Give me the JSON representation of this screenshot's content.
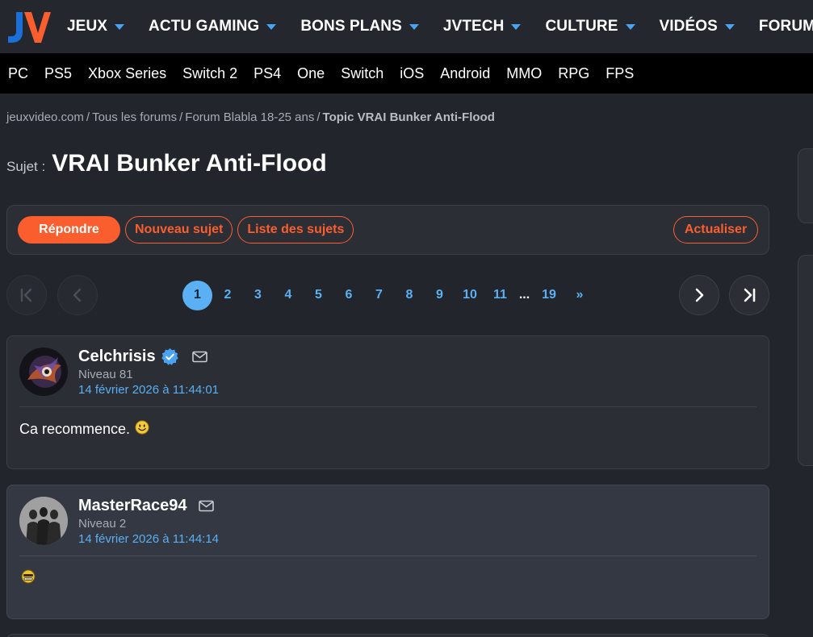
{
  "nav": {
    "items": [
      {
        "label": "JEUX"
      },
      {
        "label": "ACTU GAMING"
      },
      {
        "label": "BONS PLANS"
      },
      {
        "label": "JVTECH"
      },
      {
        "label": "CULTURE"
      },
      {
        "label": "VIDÉOS"
      },
      {
        "label": "FORUMS"
      }
    ],
    "accent": "#4aa3f0"
  },
  "subnav": {
    "items": [
      "PC",
      "PS5",
      "Xbox Series",
      "Switch 2",
      "PS4",
      "One",
      "Switch",
      "iOS",
      "Android",
      "MMO",
      "RPG",
      "FPS"
    ]
  },
  "breadcrumb": {
    "items": [
      "jeuxvideo.com",
      "Tous les forums",
      "Forum Blabla 18-25 ans"
    ],
    "separator": "/",
    "current": "Topic VRAI Bunker Anti-Flood"
  },
  "topic": {
    "prefix": "Sujet :",
    "title": "VRAI Bunker Anti-Flood"
  },
  "actions": {
    "reply": "Répondre",
    "new_topic": "Nouveau sujet",
    "topic_list": "Liste des sujets",
    "refresh": "Actualiser",
    "accent": "#fa5e2f"
  },
  "pagination": {
    "pages": [
      "1",
      "2",
      "3",
      "4",
      "5",
      "6",
      "7",
      "8",
      "9",
      "10",
      "11"
    ],
    "ellipsis": "...",
    "last": "19",
    "next_label": "»",
    "current": "1",
    "icons": [
      "first-page-icon",
      "previous-page-icon",
      "next-page-icon",
      "last-page-icon"
    ]
  },
  "posts": [
    {
      "author": "Celchrisis",
      "verified": true,
      "level": "Niveau 81",
      "date": "14 février 2026 à 11:44:01",
      "body": "Ca recommence.",
      "emoji": "smile-emoji"
    },
    {
      "author": "MasterRace94",
      "verified": false,
      "level": "Niveau 2",
      "date": "14 février 2026 à 11:44:14",
      "body": "",
      "emoji": "hap-emoji"
    }
  ]
}
